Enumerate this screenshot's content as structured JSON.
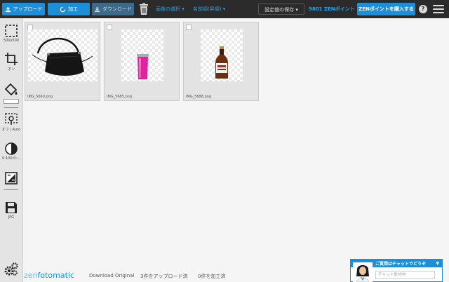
{
  "toolbar": {
    "upload_label": "アップロード",
    "process_label": "加工",
    "download_label": "ダウンロード",
    "select_menu": "画像の選択",
    "sort_menu": "名前順(昇順)",
    "save_settings": "設定値の保存",
    "points": "9801 ZENポイント",
    "buy_points": "ZENポイントを購入する",
    "help": "?"
  },
  "sidebar": {
    "tools": [
      {
        "icon": "resize-icon",
        "label": "500x500"
      },
      {
        "icon": "crop-icon",
        "label": "オン"
      },
      {
        "icon": "fill-icon",
        "label": ""
      },
      {
        "icon": "shadow-icon",
        "label": "オフ | Auto"
      },
      {
        "icon": "contrast-icon",
        "label": "0:100:0:..."
      },
      {
        "icon": "adjust-icon",
        "label": ""
      },
      {
        "icon": "save-format-icon",
        "label": "JPG"
      }
    ]
  },
  "images": [
    {
      "filename": "IMG_5660.png",
      "subject": "black handbag"
    },
    {
      "filename": "IMG_5685.png",
      "subject": "pink tumbler"
    },
    {
      "filename": "IMG_5688.png",
      "subject": "whisky bottle"
    }
  ],
  "footer": {
    "brand_zen": "zen",
    "brand_rest": "fotomatic",
    "download_original": "Download Original",
    "uploaded": "3件をアップロード済",
    "processed": "0件を加工済"
  },
  "chat": {
    "title": "ご質問はチャットでどうぞ",
    "arrow": "▼",
    "placeholder": "チャット受付中！"
  },
  "colors": {
    "accent": "#1d8fd8",
    "toolbar": "#2b2b2b",
    "sidebar": "#e4e4e4"
  }
}
